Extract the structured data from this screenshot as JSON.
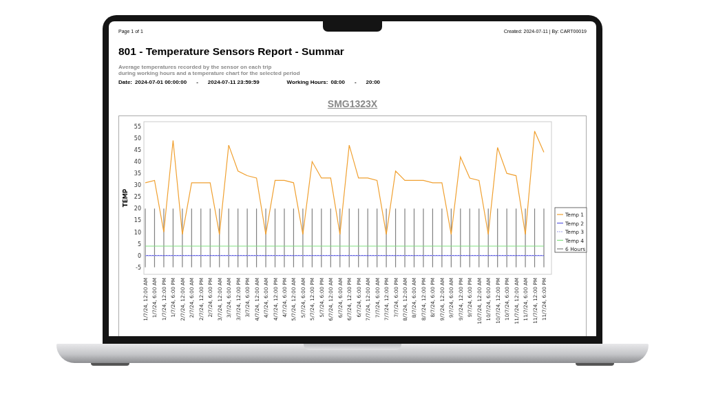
{
  "report": {
    "page_info": "Page 1 of 1",
    "created_info": "Created: 2024-07-11 | By: CART00019",
    "title": "801 - Temperature Sensors Report - Summar",
    "subtitle": "Average temperatures recorded by the sensor on each trip\nduring working hours and a temperature chart for the selected period",
    "date_range": {
      "label": "Date:",
      "from": "2024-07-01 00:00:00",
      "separator": "-",
      "to": "2024-07-11 23:59:59"
    },
    "working_hours": {
      "label": "Working Hours:",
      "from": "08:00",
      "separator": "-",
      "to": "20:00"
    },
    "vehicle": "SMG1323X",
    "chart_data": {
      "type": "line",
      "legend": "right",
      "ylabel": "TEMP",
      "ylim": [
        -8,
        57
      ],
      "yticks": [
        -5,
        0,
        5,
        10,
        15,
        20,
        25,
        30,
        35,
        40,
        45,
        50,
        55
      ],
      "categories": [
        "1/7/24, 12:00 AM",
        "1/7/24, 6:00 AM",
        "1/7/24, 12:00 PM",
        "1/7/24, 6:00 PM",
        "2/7/24, 12:00 AM",
        "2/7/24, 6:00 AM",
        "2/7/24, 12:00 PM",
        "2/7/24, 6:00 PM",
        "3/7/24, 12:00 AM",
        "3/7/24, 6:00 AM",
        "3/7/24, 12:00 PM",
        "3/7/24, 6:00 PM",
        "4/7/24, 12:00 AM",
        "4/7/24, 6:00 AM",
        "4/7/24, 12:00 PM",
        "4/7/24, 6:00 PM",
        "5/7/24, 12:00 AM",
        "5/7/24, 6:00 AM",
        "5/7/24, 12:00 PM",
        "5/7/24, 6:00 PM",
        "6/7/24, 12:00 AM",
        "6/7/24, 6:00 AM",
        "6/7/24, 12:00 PM",
        "6/7/24, 6:00 PM",
        "7/7/24, 12:00 AM",
        "7/7/24, 6:00 AM",
        "7/7/24, 12:00 PM",
        "7/7/24, 6:00 PM",
        "8/7/24, 12:00 AM",
        "8/7/24, 6:00 AM",
        "8/7/24, 12:00 PM",
        "8/7/24, 6:00 PM",
        "9/7/24, 12:00 AM",
        "9/7/24, 6:00 AM",
        "9/7/24, 12:00 PM",
        "9/7/24, 6:00 PM",
        "10/7/24, 12:00 AM",
        "10/7/24, 6:00 AM",
        "10/7/24, 12:00 PM",
        "10/7/24, 6:00 PM",
        "11/7/24, 12:00 AM",
        "11/7/24, 6:00 AM",
        "11/7/24, 12:00 PM",
        "11/7/24, 6:00 PM"
      ],
      "series": [
        {
          "name": "Temp 1",
          "color": "#f0a030",
          "line_style": "solid",
          "values": [
            31,
            32,
            10,
            49,
            9,
            31,
            31,
            31,
            9,
            47,
            36,
            34,
            33,
            9,
            32,
            32,
            31,
            9,
            40,
            33,
            33,
            9,
            47,
            33,
            33,
            32,
            9,
            36,
            32,
            32,
            32,
            31,
            31,
            9,
            42,
            33,
            32,
            9,
            46,
            35,
            34,
            9,
            53,
            44
          ]
        },
        {
          "name": "Temp 2",
          "color": "#5a5ae0",
          "line_style": "solid",
          "values": [
            0,
            0,
            0,
            0,
            0,
            0,
            0,
            0,
            0,
            0,
            0,
            0,
            0,
            0,
            0,
            0,
            0,
            0,
            0,
            0,
            0,
            0,
            0,
            0,
            0,
            0,
            0,
            0,
            0,
            0,
            0,
            0,
            0,
            0,
            0,
            0,
            0,
            0,
            0,
            0,
            0,
            0,
            0,
            0
          ]
        },
        {
          "name": "Temp 3",
          "color": "#9a9ae8",
          "line_style": "dashed",
          "values": [
            0,
            0,
            0,
            0,
            0,
            0,
            0,
            0,
            0,
            0,
            0,
            0,
            0,
            0,
            0,
            0,
            0,
            0,
            0,
            0,
            0,
            0,
            0,
            0,
            0,
            0,
            0,
            0,
            0,
            0,
            0,
            0,
            0,
            0,
            0,
            0,
            0,
            0,
            0,
            0,
            0,
            0,
            0,
            0
          ]
        },
        {
          "name": "Temp 4",
          "color": "#80e080",
          "line_style": "solid",
          "values": [
            4,
            4,
            4,
            4,
            4,
            4,
            4,
            4,
            4,
            4,
            4,
            4,
            4,
            4,
            4,
            4,
            4,
            4,
            4,
            4,
            4,
            4,
            4,
            4,
            4,
            4,
            4,
            4,
            4,
            4,
            4,
            4,
            4,
            4,
            4,
            4,
            4,
            4,
            4,
            4,
            4,
            4,
            4,
            4
          ]
        },
        {
          "name": "6 Hours",
          "color": "#808080",
          "line_style": "vertical",
          "values": [
            null,
            null,
            null,
            null,
            null,
            null,
            null,
            null,
            null,
            null,
            null,
            null,
            null,
            null,
            null,
            null,
            null,
            null,
            null,
            null,
            null,
            null,
            null,
            null,
            null,
            null,
            null,
            null,
            null,
            null,
            null,
            null,
            null,
            null,
            null,
            null,
            null,
            null,
            null,
            null,
            null,
            null,
            null,
            null
          ]
        }
      ]
    }
  }
}
